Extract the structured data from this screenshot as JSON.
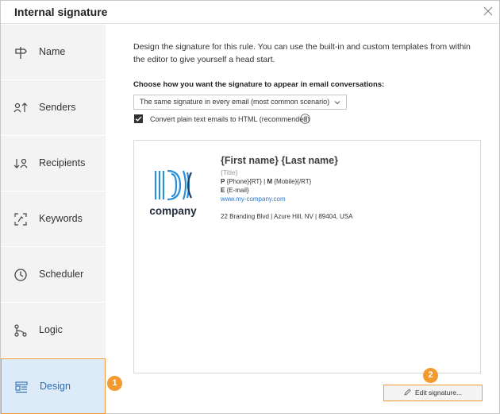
{
  "window": {
    "title": "Internal signature"
  },
  "sidebar": {
    "items": [
      {
        "label": "Name",
        "icon": "signpost-icon"
      },
      {
        "label": "Senders",
        "icon": "senders-icon"
      },
      {
        "label": "Recipients",
        "icon": "recipients-icon"
      },
      {
        "label": "Keywords",
        "icon": "keywords-icon"
      },
      {
        "label": "Scheduler",
        "icon": "clock-icon"
      },
      {
        "label": "Logic",
        "icon": "logic-icon"
      },
      {
        "label": "Design",
        "icon": "design-icon",
        "active": true
      }
    ]
  },
  "markers": {
    "one": "1",
    "two": "2"
  },
  "main": {
    "description": "Design the signature for this rule. You can use the built-in and custom templates from within the editor to give yourself a head start.",
    "choose_label": "Choose how you want the signature to appear in email conversations:",
    "select_value": "The same signature in every email (most common scenario)",
    "convert_label": "Convert plain text emails to HTML (recommended)",
    "convert_checked": true,
    "edit_button": "Edit signature..."
  },
  "signature": {
    "name": "{First name} {Last name}",
    "title": "{Title}",
    "phone_prefix": "P",
    "phone": "{Phone}{RT} |",
    "mobile_prefix": "M",
    "mobile": "{Mobile}{/RT}",
    "email_prefix": "E",
    "email": "{E-mail}",
    "website": "www.my-company.com",
    "address": "22 Branding Blvd | Azure Hill, NV | 89404, USA",
    "logo_text": "company"
  },
  "colors": {
    "accent": "#f29a2e",
    "active_bg": "#dcebf7",
    "link": "#2e74c7",
    "logo_blue": "#2a8fd6",
    "logo_dark": "#1f3d6b"
  }
}
